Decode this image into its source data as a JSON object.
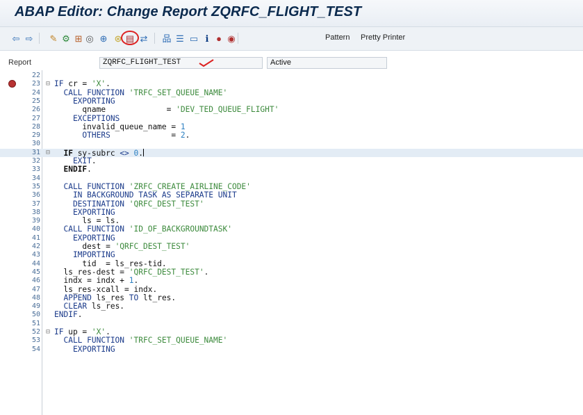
{
  "window": {
    "title": "ABAP Editor: Change Report ZQRFC_FLIGHT_TEST"
  },
  "toolbar": {
    "buttons": [
      {
        "name": "back-arrow-icon",
        "glyph": "⇦",
        "color": "#2f6db5"
      },
      {
        "name": "forward-arrow-icon",
        "glyph": "⇨",
        "color": "#2f6db5"
      },
      {
        "name": "display-change-icon",
        "glyph": "✎",
        "color": "#c2862b"
      },
      {
        "name": "active-inactive-icon",
        "glyph": "⚙",
        "color": "#2f8a3c"
      },
      {
        "name": "check-syntax-icon",
        "glyph": "⊞",
        "color": "#b8602a"
      },
      {
        "name": "activate-icon",
        "glyph": "◎",
        "color": "#555555"
      },
      {
        "name": "test-icon",
        "glyph": "⊕",
        "color": "#2f6db5"
      },
      {
        "name": "where-used-icon",
        "glyph": "⊛",
        "color": "#c4a62b"
      },
      {
        "name": "object-list-icon",
        "glyph": "▤",
        "color": "#b03030"
      },
      {
        "name": "navigation-window-icon",
        "glyph": "⇄",
        "color": "#2f6db5"
      },
      {
        "name": "hierarchy-icon",
        "glyph": "品",
        "color": "#2f6db5"
      },
      {
        "name": "layout-icon",
        "glyph": "☰",
        "color": "#2f6db5"
      },
      {
        "name": "window-icon",
        "glyph": "▭",
        "color": "#2f6db5"
      },
      {
        "name": "info-icon",
        "glyph": "ℹ",
        "color": "#0b3b82"
      },
      {
        "name": "set-breakpoint-icon",
        "glyph": "●",
        "color": "#b03030"
      },
      {
        "name": "session-breakpoint-icon",
        "glyph": "◉",
        "color": "#b03030"
      }
    ],
    "pattern_label": "Pattern",
    "pretty_printer_label": "Pretty Printer"
  },
  "report": {
    "label": "Report",
    "name": "ZQRFC_FLIGHT_TEST",
    "status": "Active"
  },
  "editor": {
    "lines": [
      {
        "n": "22",
        "t": ""
      },
      {
        "n": "23",
        "fold": "⊟",
        "bp": true,
        "segs": [
          [
            "kw",
            "IF "
          ],
          [
            "plain",
            "cr = "
          ],
          [
            "str",
            "'X'"
          ],
          [
            "plain",
            "."
          ]
        ]
      },
      {
        "n": "24",
        "segs": [
          [
            "kw",
            "  CALL FUNCTION "
          ],
          [
            "str",
            "'TRFC_SET_QUEUE_NAME'"
          ]
        ]
      },
      {
        "n": "25",
        "segs": [
          [
            "kw",
            "    EXPORTING"
          ]
        ]
      },
      {
        "n": "26",
        "segs": [
          [
            "plain",
            "      qname             = "
          ],
          [
            "str",
            "'DEV_TED_QUEUE_FLIGHT'"
          ]
        ]
      },
      {
        "n": "27",
        "segs": [
          [
            "kw",
            "    EXCEPTIONS"
          ]
        ]
      },
      {
        "n": "28",
        "segs": [
          [
            "plain",
            "      invalid_queue_name = "
          ],
          [
            "num",
            "1"
          ]
        ]
      },
      {
        "n": "29",
        "segs": [
          [
            "kw",
            "      OTHERS"
          ],
          [
            "plain",
            "             = "
          ],
          [
            "num",
            "2"
          ],
          [
            "plain",
            "."
          ]
        ]
      },
      {
        "n": "30",
        "t": ""
      },
      {
        "n": "31",
        "fold": "⊟",
        "hl": true,
        "cursor": true,
        "segs": [
          [
            "kwb",
            "  IF "
          ],
          [
            "plain",
            "sy-subrc "
          ],
          [
            "kw",
            "<> "
          ],
          [
            "num",
            "0"
          ],
          [
            "plain",
            "."
          ]
        ]
      },
      {
        "n": "32",
        "segs": [
          [
            "kw",
            "    EXIT"
          ],
          [
            "plain",
            "."
          ]
        ]
      },
      {
        "n": "33",
        "segs": [
          [
            "kwb",
            "  ENDIF"
          ],
          [
            "plain",
            "."
          ]
        ]
      },
      {
        "n": "34",
        "t": ""
      },
      {
        "n": "35",
        "segs": [
          [
            "kw",
            "  CALL FUNCTION "
          ],
          [
            "str",
            "'ZRFC_CREATE_AIRLINE_CODE'"
          ]
        ]
      },
      {
        "n": "36",
        "segs": [
          [
            "kw",
            "    IN BACKGROUND TASK AS SEPARATE UNIT"
          ]
        ]
      },
      {
        "n": "37",
        "segs": [
          [
            "kw",
            "    DESTINATION "
          ],
          [
            "str",
            "'QRFC_DEST_TEST'"
          ]
        ]
      },
      {
        "n": "38",
        "segs": [
          [
            "kw",
            "    EXPORTING"
          ]
        ]
      },
      {
        "n": "39",
        "segs": [
          [
            "plain",
            "      ls = ls."
          ]
        ]
      },
      {
        "n": "40",
        "segs": [
          [
            "kw",
            "  CALL FUNCTION "
          ],
          [
            "str",
            "'ID_OF_BACKGROUNDTASK'"
          ]
        ]
      },
      {
        "n": "41",
        "segs": [
          [
            "kw",
            "    EXPORTING"
          ]
        ]
      },
      {
        "n": "42",
        "segs": [
          [
            "plain",
            "      dest = "
          ],
          [
            "str",
            "'QRFC_DEST_TEST'"
          ]
        ]
      },
      {
        "n": "43",
        "segs": [
          [
            "kw",
            "    IMPORTING"
          ]
        ]
      },
      {
        "n": "44",
        "segs": [
          [
            "plain",
            "      tid  = ls_res-tid."
          ]
        ]
      },
      {
        "n": "45",
        "segs": [
          [
            "plain",
            "  ls_res-dest = "
          ],
          [
            "str",
            "'QRFC_DEST_TEST'"
          ],
          [
            "plain",
            "."
          ]
        ]
      },
      {
        "n": "46",
        "segs": [
          [
            "plain",
            "  indx = indx + "
          ],
          [
            "num",
            "1"
          ],
          [
            "plain",
            "."
          ]
        ]
      },
      {
        "n": "47",
        "segs": [
          [
            "plain",
            "  ls_res-xcall = indx."
          ]
        ]
      },
      {
        "n": "48",
        "segs": [
          [
            "kw",
            "  APPEND "
          ],
          [
            "plain",
            "ls_res "
          ],
          [
            "kw",
            "TO "
          ],
          [
            "plain",
            "lt_res."
          ]
        ]
      },
      {
        "n": "49",
        "segs": [
          [
            "kw",
            "  CLEAR "
          ],
          [
            "plain",
            "ls_res."
          ]
        ]
      },
      {
        "n": "50",
        "segs": [
          [
            "kw",
            "ENDIF"
          ],
          [
            "plain",
            "."
          ]
        ]
      },
      {
        "n": "51",
        "t": ""
      },
      {
        "n": "52",
        "fold": "⊟",
        "segs": [
          [
            "kw",
            "IF "
          ],
          [
            "plain",
            "up = "
          ],
          [
            "str",
            "'X'"
          ],
          [
            "plain",
            "."
          ]
        ]
      },
      {
        "n": "53",
        "segs": [
          [
            "kw",
            "  CALL FUNCTION "
          ],
          [
            "str",
            "'TRFC_SET_QUEUE_NAME'"
          ]
        ]
      },
      {
        "n": "54",
        "segs": [
          [
            "kw",
            "    EXPORTING"
          ]
        ]
      }
    ]
  }
}
